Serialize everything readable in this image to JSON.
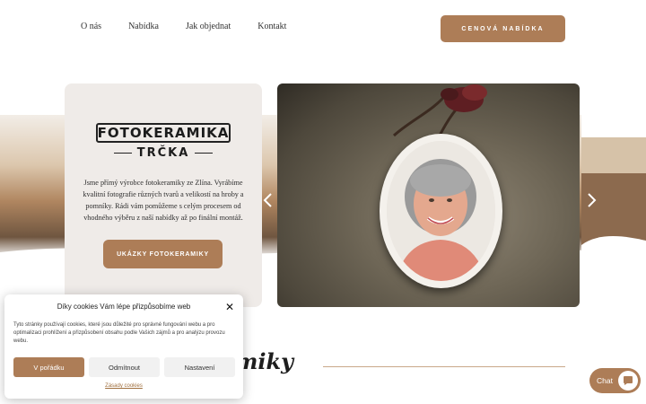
{
  "nav": {
    "items": [
      "O nás",
      "Nabídka",
      "Jak objednat",
      "Kontakt"
    ],
    "cta_label": "CENOVÁ NABÍDKA"
  },
  "hero": {
    "logo_main": "FOTOKERAMIKA",
    "logo_sub": "TRČKA",
    "description": "Jsme přímý výrobce fotokeramiky ze Zlína. Vyrábíme kvalitní fotografie různých tvarů a velikostí na hroby a pomníky. Rádi vám pomůžeme s celým procesem od vhodného výběru z naší nabídky až po finální montáž.",
    "button_label": "UKÁZKY FOTOKERAMIKY"
  },
  "slider": {
    "prev_icon": "chevron-left-icon",
    "next_icon": "chevron-right-icon"
  },
  "section": {
    "title_fragment": "miky"
  },
  "cookie": {
    "title": "Díky cookies Vám lépe přizpůsobíme web",
    "text": "Tyto stránky používají cookies, které jsou důležité pro správné fungování webu a pro optimalizaci prohlížení a přizpůsobení obsahu podle Vašich zájmů a pro analýzu provozu webu.",
    "accept_label": "V pořádku",
    "reject_label": "Odmítnout",
    "settings_label": "Nastavení",
    "policy_link": "Zásady cookies"
  },
  "chat": {
    "label": "Chat"
  },
  "colors": {
    "accent": "#ad7d57",
    "card_bg": "#efebe8",
    "text": "#2b2b2b"
  }
}
